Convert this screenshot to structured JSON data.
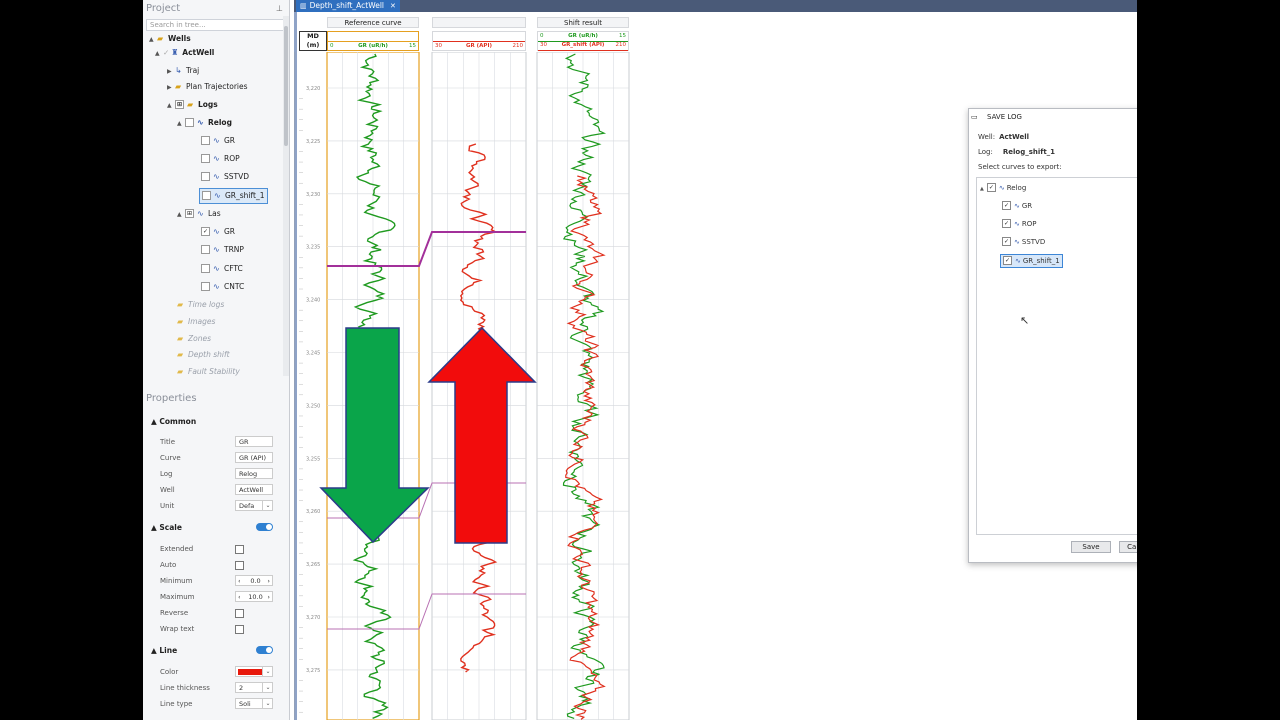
{
  "project": {
    "title": "Project",
    "search_placeholder": "Search in tree...",
    "tree": [
      {
        "label": "Wells",
        "bold": true
      },
      {
        "label": "ActWell",
        "bold": true
      },
      {
        "label": "Traj"
      },
      {
        "label": "Plan Trajectories"
      },
      {
        "label": "Logs",
        "bold": true
      },
      {
        "label": "Relog",
        "bold": true
      },
      {
        "label": "GR"
      },
      {
        "label": "ROP"
      },
      {
        "label": "SSTVD"
      },
      {
        "label": "GR_shift_1"
      },
      {
        "label": "Las"
      },
      {
        "label": "GR"
      },
      {
        "label": "TRNP"
      },
      {
        "label": "CFTC"
      },
      {
        "label": "CNTC"
      },
      {
        "label": "Time logs"
      },
      {
        "label": "Images"
      },
      {
        "label": "Zones"
      },
      {
        "label": "Depth shift"
      },
      {
        "label": "Fault Stability"
      }
    ]
  },
  "properties": {
    "title": "Properties",
    "common": {
      "label": "Common",
      "title_label": "Title",
      "title_value": "GR",
      "curve_label": "Curve",
      "curve_value": "GR (API)",
      "log_label": "Log",
      "log_value": "Relog",
      "well_label": "Well",
      "well_value": "ActWell",
      "unit_label": "Unit",
      "unit_value": "Defa"
    },
    "scale": {
      "label": "Scale",
      "enabled": true,
      "extended_label": "Extended",
      "auto_label": "Auto",
      "minimum_label": "Minimum",
      "minimum_value": "0.0",
      "maximum_label": "Maximum",
      "maximum_value": "10.0",
      "reverse_label": "Reverse",
      "wrap_label": "Wrap text"
    },
    "line": {
      "label": "Line",
      "enabled": true,
      "color_label": "Color",
      "color_value": "#e8190c",
      "thickness_label": "Line thickness",
      "thickness_value": "2",
      "type_label": "Line type",
      "type_value": "Soli"
    }
  },
  "tab": {
    "label": "Depth_shift_ActWell"
  },
  "tracks": {
    "md_header": [
      "MD",
      "(m)"
    ],
    "depth_ticks": [
      "3,220",
      "3,225",
      "3,230",
      "3,235",
      "3,240",
      "3,245",
      "3,250",
      "3,255",
      "3,260",
      "3,265",
      "3,270",
      "3,275"
    ],
    "reference": {
      "title": "Reference curve",
      "curve": "GR (uR/h)",
      "min": "0",
      "max": "15",
      "color": "#1f9a1f"
    },
    "shift": {
      "curve": "GR (API)",
      "min": "30",
      "max": "210",
      "color": "#e0301e"
    },
    "result": {
      "title": "Shift result",
      "curve1": "GR (uR/h)",
      "curve1_min": "0",
      "curve1_max": "15",
      "curve2": "GR_shift (API)",
      "curve2_min": "30",
      "curve2_max": "210"
    },
    "arrow_down_color": "#0aa54a",
    "arrow_up_color": "#f20c0c"
  },
  "dialog": {
    "title": "SAVE LOG",
    "well_label": "Well:",
    "well_value": "ActWell",
    "log_label": "Log:",
    "log_value": "Relog_shift_1",
    "prompt": "Select curves to export:",
    "root": "Relog",
    "items": [
      "GR",
      "ROP",
      "SSTVD",
      "GR_shift_1"
    ],
    "save": "Save",
    "cancel": "Cancel"
  }
}
